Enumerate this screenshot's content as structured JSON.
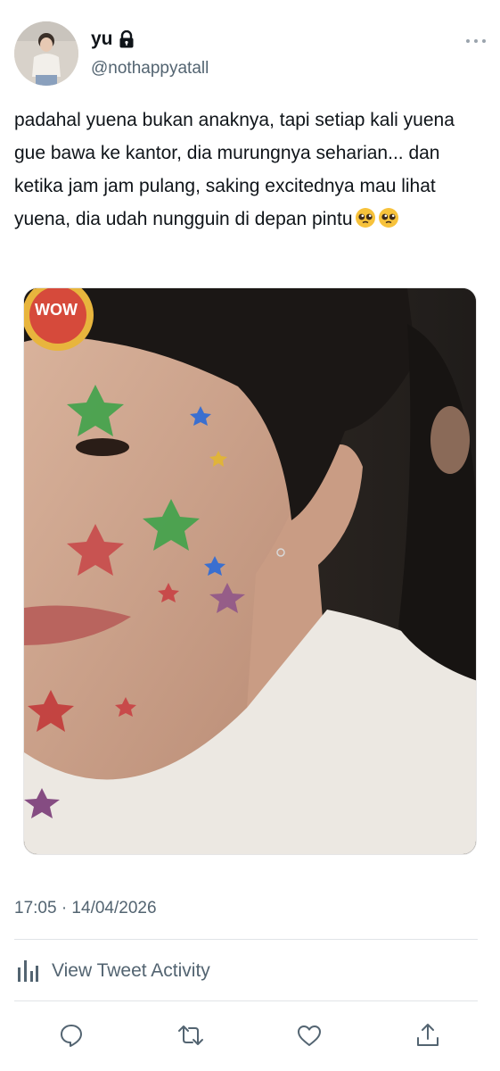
{
  "user": {
    "display_name": "yu",
    "handle": "@nothappyatall",
    "lock_icon": "lock-icon",
    "avatar_alt": "profile photo"
  },
  "tweet": {
    "text": "padahal yuena bukan anaknya, tapi setiap kali yuena gue bawa ke kantor, dia murungnya seharian... dan ketika jam jam pulang, saking excitednya mau lihat yuena, dia udah nungguin di depan pintu",
    "emojis": [
      "pleading-face-emoji",
      "pleading-face-emoji"
    ],
    "media_sticker_text": "WOW",
    "timestamp": "17:05 · 14/04/2026"
  },
  "activity": {
    "label": "View Tweet Activity",
    "icon": "bar-chart-icon"
  },
  "actions": [
    {
      "name": "reply",
      "icon": "reply-icon"
    },
    {
      "name": "retweet",
      "icon": "retweet-icon"
    },
    {
      "name": "like",
      "icon": "heart-icon"
    },
    {
      "name": "share",
      "icon": "share-icon"
    }
  ],
  "colors": {
    "text_primary": "#0f1419",
    "text_secondary": "#536471",
    "divider": "#e1e4e7"
  }
}
